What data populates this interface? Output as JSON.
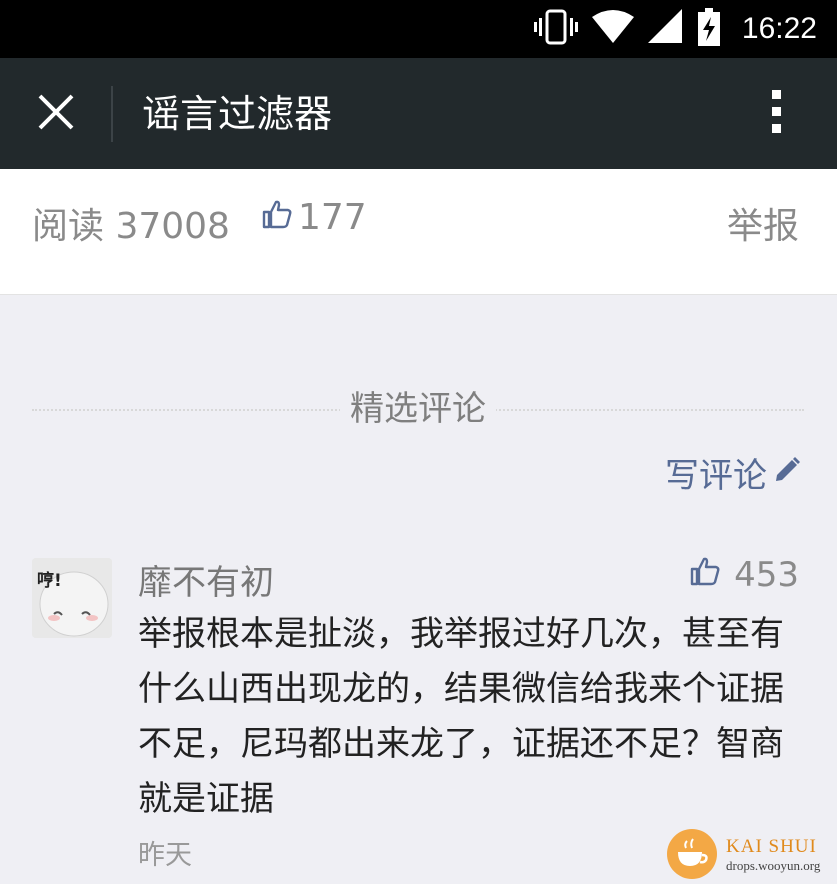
{
  "status_bar": {
    "time": "16:22",
    "icons": [
      "vibrate-icon",
      "wifi-icon",
      "signal-icon",
      "battery-charging-icon"
    ]
  },
  "app_bar": {
    "title": "谣言过滤器",
    "close_icon": "close-icon",
    "more_icon": "more-vertical-icon"
  },
  "article_meta": {
    "read_label": "阅读 37008",
    "like_count": "177",
    "report_label": "举报"
  },
  "comments_section": {
    "title": "精选评论",
    "write_label": "写评论"
  },
  "comments": [
    {
      "author": "靡不有初",
      "likes": "453",
      "avatar_text": "哼!",
      "text": "举报根本是扯淡，我举报过好几次，甚至有什么山西出现龙的，结果微信给我来个证据不足，尼玛都出来龙了，证据还不足？智商就是证据",
      "time": "昨天"
    }
  ],
  "watermark": {
    "title": "KAI SHUI",
    "subtitle": "drops.wooyun.org"
  },
  "colors": {
    "status_bar": "#000000",
    "app_bar": "#22292c",
    "background": "#efeff4",
    "link": "#576b95",
    "muted_text": "#8a8a8a"
  }
}
